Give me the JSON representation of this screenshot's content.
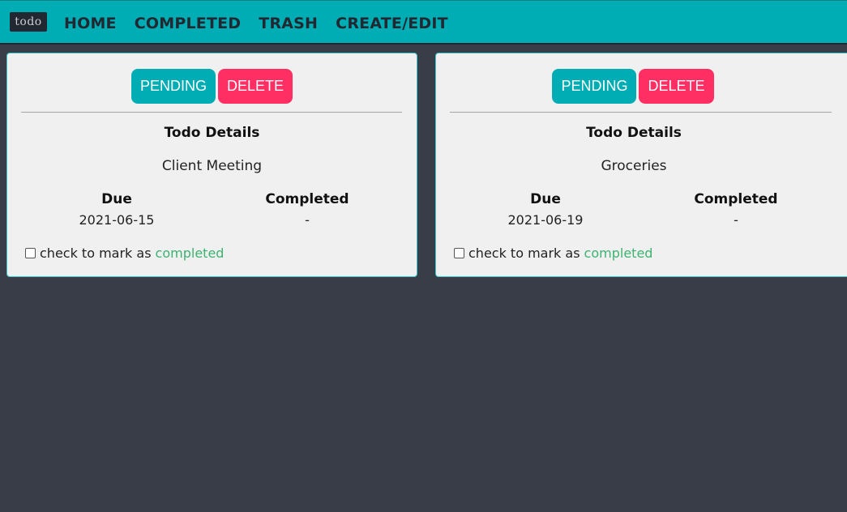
{
  "nav": {
    "logo_text": "todo",
    "links": [
      "HOME",
      "COMPLETED",
      "TRASH",
      "CREATE/EDIT"
    ]
  },
  "cards": [
    {
      "pending_label": "PENDING",
      "delete_label": "DELETE",
      "details_title": "Todo Details",
      "name": "Client Meeting",
      "due_label": "Due",
      "due_value": "2021-06-15",
      "completed_label": "Completed",
      "completed_value": "-",
      "check_text": "check to mark as",
      "check_completed_word": "completed"
    },
    {
      "pending_label": "PENDING",
      "delete_label": "DELETE",
      "details_title": "Todo Details",
      "name": "Groceries",
      "due_label": "Due",
      "due_value": "2021-06-19",
      "completed_label": "Completed",
      "completed_value": "-",
      "check_text": "check to mark as",
      "check_completed_word": "completed"
    }
  ],
  "colors": {
    "accent": "#00adb5",
    "danger": "#ff2e63",
    "background": "#393d47",
    "completed_text": "#3cb371"
  }
}
